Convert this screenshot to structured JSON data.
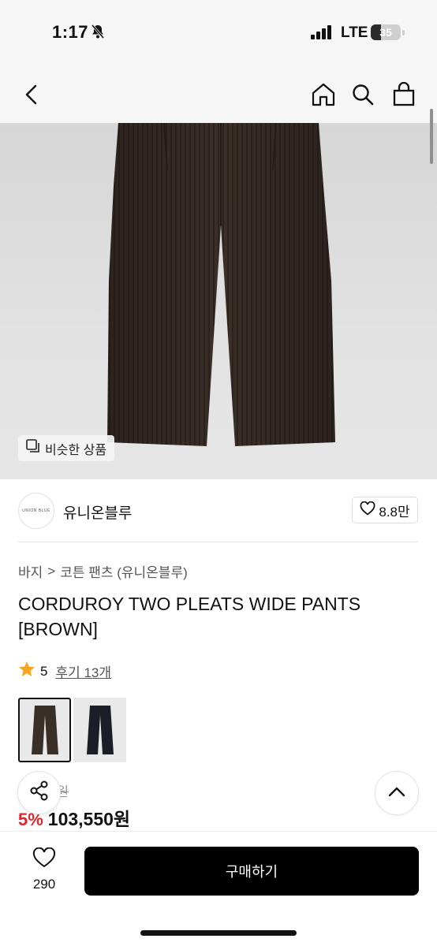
{
  "status_bar": {
    "time": "1:17",
    "network": "LTE",
    "battery": "35",
    "battery_level": 0.35
  },
  "nav": {
    "icons": [
      "back-icon",
      "home-icon",
      "search-icon",
      "shopping-bag-icon"
    ]
  },
  "product_image": {
    "similar_label": "비슷한 상품"
  },
  "brand": {
    "logo_text": "UNION BLUE",
    "name": "유니온블루",
    "likes": "8.8만"
  },
  "breadcrumb": {
    "category": "바지",
    "separator": ">",
    "subcategory": "코튼 팬츠 (유니온블루)"
  },
  "product": {
    "title": "CORDUROY TWO PLEATS WIDE PANTS [BROWN]"
  },
  "rating": {
    "score": "5",
    "reviews": "후기 13개"
  },
  "color_options": [
    {
      "name": "brown",
      "color": "#3a2f27",
      "selected": true
    },
    {
      "name": "navy",
      "color": "#1b1e26",
      "selected": false
    }
  ],
  "price": {
    "original_partial": "0원",
    "discount": "5%",
    "sale": "103,550원",
    "discount_color": "#e0262d"
  },
  "bottom_bar": {
    "wish_count": "290",
    "buy_label": "구매하기"
  }
}
